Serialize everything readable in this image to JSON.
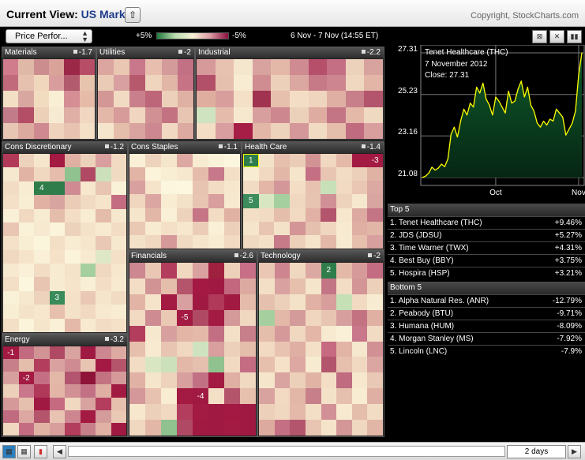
{
  "header": {
    "title_prefix": "Current View: ",
    "title_value": "US Market",
    "up_icon": "upload-arrow-icon",
    "copyright": "Copyright, StockCharts.com"
  },
  "toolbar": {
    "view_select": "Price Perfor...",
    "legend_pos": "+5%",
    "legend_neg": "-5%",
    "date_range": "6 Nov - 7 Nov (14:55 ET)",
    "buttons": [
      "zoom-icon",
      "tools-icon",
      "chart-icon"
    ]
  },
  "sectors": [
    {
      "name": "Materials",
      "change": "-1.7",
      "cols": 6,
      "rows": 5,
      "colors": [
        "#d07c8c",
        "#e0b8a8",
        "#cc8d8f",
        "#d9a399",
        "#9c2848",
        "#b84d68",
        "#c06a7c",
        "#e7c1b0",
        "#f0d6bc",
        "#d99d9e",
        "#b25a6e",
        "#e7c4ad",
        "#f3dfc4",
        "#d8a8a0",
        "#f2dcc0",
        "#f9efd5",
        "#d58e94",
        "#e6bca9",
        "#c27c89",
        "#b44e67",
        "#ecd0b8",
        "#f7ead2",
        "#dfaea5",
        "#f1d7c1",
        "#e8c6b4",
        "#dcaa9e",
        "#cf8a91",
        "#f0d3bd",
        "#e8c3b2",
        "#f3e0c6"
      ],
      "marks": []
    },
    {
      "name": "Utilities",
      "change": "-2",
      "cols": 6,
      "rows": 5,
      "colors": [
        "#dca6a0",
        "#e9c7b2",
        "#c8788a",
        "#e8bfae",
        "#d49b9b",
        "#c27185",
        "#eacbb6",
        "#d8a0a0",
        "#b7596c",
        "#efd5bd",
        "#e2b6a7",
        "#c67485",
        "#d39796",
        "#f2dbc3",
        "#c9808c",
        "#bd6679",
        "#ecd0ba",
        "#dfb0a4",
        "#e4b8a8",
        "#d79b9a",
        "#f0d6c0",
        "#d09094",
        "#c37282",
        "#e8c5b3",
        "#f5e5cc",
        "#e5bdab",
        "#d9a4a0",
        "#cc8790",
        "#f1d8c2",
        "#dcaaa1"
      ],
      "marks": []
    },
    {
      "name": "Industrial",
      "change": "-2.2",
      "cols": 10,
      "rows": 5,
      "colors": [
        "#d59a99",
        "#e8c2b1",
        "#f5e7cd",
        "#d8a29f",
        "#e3b8a8",
        "#cf8b92",
        "#b6506a",
        "#c46f83",
        "#edd2bb",
        "#d8a39f",
        "#b2506a",
        "#e6c0ae",
        "#f8ecd2",
        "#cf8d92",
        "#edd0ba",
        "#dba7a1",
        "#c67a87",
        "#cd8590",
        "#f0d7c0",
        "#e3b5a7",
        "#dfae9f",
        "#d79e9c",
        "#f3e0c6",
        "#a0334f",
        "#e6bfad",
        "#f3dec5",
        "#efd5be",
        "#dfafa3",
        "#c7808a",
        "#b3556c",
        "#cfe3c0",
        "#e5bcab",
        "#f6e8ce",
        "#d7a09e",
        "#cd878f",
        "#ecd1ba",
        "#dfaca2",
        "#c37585",
        "#e4b9a8",
        "#f0d9c1",
        "#f3dec5",
        "#d99fa0",
        "#a61d45",
        "#e3b7a8",
        "#eed3bc",
        "#d5989a",
        "#f1dbc2",
        "#e5bdab",
        "#c06b80",
        "#d99f9e"
      ],
      "marks": []
    },
    {
      "name": "Cons Discretionary",
      "change": "-1.2",
      "cols": 8,
      "rows": 13,
      "colors": [
        "#b23a59",
        "#edd2bb",
        "#f5e6cc",
        "#a31a42",
        "#e0b0a3",
        "#ecd1ba",
        "#d99e9e",
        "#f1d9c2",
        "#f5e8ce",
        "#e1b3a5",
        "#f0d7c0",
        "#e6bdac",
        "#8fc28f",
        "#b04a64",
        "#cde0bc",
        "#f0dac2",
        "#f2ddc4",
        "#f8edd3",
        "#e7c2b0",
        "#2e7d4b",
        "#cf8b91",
        "#f6e7cd",
        "#e8c4b2",
        "#f9f1d8",
        "#f3e0c6",
        "#f8eed4",
        "#e1b2a4",
        "#d8a49f",
        "#ebcdb7",
        "#f1dac2",
        "#f5e4ca",
        "#c46d82",
        "#f9f0d7",
        "#f0d8c1",
        "#f7ebd1",
        "#e5bdab",
        "#f3dec5",
        "#f8ecd2",
        "#e4bcaa",
        "#f6e8ce",
        "#e8c6b3",
        "#f9f1d8",
        "#f6e9cf",
        "#fbf4db",
        "#edd2bb",
        "#f4e2c8",
        "#f7ead0",
        "#f2dcc3",
        "#f4e1c7",
        "#f8eed4",
        "#fbf5dc",
        "#f3dfc6",
        "#f8ecd2",
        "#f5e6cc",
        "#e9c9b5",
        "#f6e8ce",
        "#f0d7c0",
        "#f5e4ca",
        "#f9f0d7",
        "#f4e1c7",
        "#fbf4db",
        "#f7ead0",
        "#dfe8c6",
        "#f3e0c6",
        "#f6e9cf",
        "#f9f0d7",
        "#f2dcc3",
        "#f7ebd1",
        "#f4e3c9",
        "#a6cf9f",
        "#f0d7c0",
        "#f6e7cd",
        "#f3dfc6",
        "#fbf6dd",
        "#e8c5b3",
        "#f7ebd1",
        "#f5e4ca",
        "#f9efd6",
        "#f3dec5",
        "#f7ead0",
        "#f9f1d8",
        "#f6e8ce",
        "#eed3bc",
        "#3a8b5a",
        "#f4e1c7",
        "#e9c9b5",
        "#f5e5cb",
        "#f2dbc3",
        "#f8eed4",
        "#f4e3c9",
        "#f6e7cd",
        "#e6bfad",
        "#f4e2c8",
        "#f1d8c1",
        "#f6e9cf",
        "#f8ecd2",
        "#f3dfc6",
        "#fbf4db",
        "#f5e5cb",
        "#f9f0d7",
        "#e4b9a9",
        "#f7ead0",
        "#f2dcc3",
        "#f4e1c7"
      ],
      "marks": [
        {
          "i": 18,
          "t": "4",
          "c": "#2e7d4b"
        },
        {
          "i": 83,
          "t": "3",
          "c": "#3a8b5a"
        }
      ]
    },
    {
      "name": "Cons Staples",
      "change": "-1.1",
      "cols": 7,
      "rows": 7,
      "colors": [
        "#f9f0d7",
        "#eed3bc",
        "#f5e5cb",
        "#dca8a1",
        "#f7ebd1",
        "#f9f1d8",
        "#fbf6dd",
        "#e2b4a6",
        "#fbf4db",
        "#f8eed4",
        "#f6e8ce",
        "#e5bcab",
        "#c7788a",
        "#f3dfc6",
        "#d8a09f",
        "#f5e4ca",
        "#fbf6dd",
        "#fcf7de",
        "#e7c3b1",
        "#f2dcc3",
        "#f6e7cd",
        "#f0d6bf",
        "#dba6a1",
        "#f8ecd2",
        "#f4e2c8",
        "#e8c5b3",
        "#d89f9e",
        "#f6e9cf",
        "#f5e5cb",
        "#e3b7a8",
        "#f9f0d7",
        "#eed3bc",
        "#c57585",
        "#f2dcc3",
        "#e0b2a4",
        "#e9c8b4",
        "#f7ebd1",
        "#f3e0c6",
        "#f6e7cd",
        "#ebcdb7",
        "#f9f0d7",
        "#ecd0ba",
        "#f4e2c8",
        "#f0d7c0",
        "#d6999a",
        "#f1dac2",
        "#f5e5cb",
        "#f8ecd2",
        "#f1d9c2"
      ],
      "marks": []
    },
    {
      "name": "Health Care",
      "change": "-1.4",
      "cols": 9,
      "rows": 7,
      "colors": [
        "#2e7d4b",
        "#f4e2c8",
        "#e6bfad",
        "#ebcdb7",
        "#d29395",
        "#f0d7c0",
        "#e4b9a8",
        "#a31a42",
        "#f4e1c7",
        "#f8ecd2",
        "#f0d8c1",
        "#e3b7a8",
        "#f5e5cb",
        "#c46f83",
        "#e8c5b3",
        "#f2dcc3",
        "#ecd0ba",
        "#e0b2a4",
        "#f2dbc3",
        "#e3b6a7",
        "#d3979a",
        "#f3dec5",
        "#e7c2b0",
        "#c8e0b8",
        "#f1d9c2",
        "#e9c7b4",
        "#dca9a2",
        "#3c8c5c",
        "#d9e6c2",
        "#a6cf9f",
        "#f0d7c0",
        "#e7c3b1",
        "#d09096",
        "#eed3bc",
        "#f6e8ce",
        "#d9a5a0",
        "#f3dfc6",
        "#f2dbc3",
        "#e5bdab",
        "#f1d9c2",
        "#e0b1a4",
        "#b3556c",
        "#f6e7cd",
        "#dcaaa1",
        "#c37585",
        "#f5e5cb",
        "#e8c5b3",
        "#f4e2c8",
        "#d39596",
        "#e6c0ae",
        "#f0d6bf",
        "#f7ead0",
        "#dfafa3",
        "#e2b6a7",
        "#f0d9c1",
        "#f3e0c6",
        "#c77a88",
        "#ecd0ba",
        "#f5e4ca",
        "#e3b8a8",
        "#f7ebd1",
        "#e6bfad",
        "#d7a09e"
      ],
      "marks": [
        {
          "i": 0,
          "t": "1",
          "c": "#2e7d4b",
          "b": true
        },
        {
          "i": 8,
          "t": "-3",
          "c": "#a31a42"
        },
        {
          "i": 27,
          "t": "5",
          "c": "#3c8c5c"
        }
      ]
    },
    {
      "name": "Financials",
      "change": "-2.6",
      "cols": 8,
      "rows": 11,
      "colors": [
        "#cc8790",
        "#e9c7b4",
        "#b23d5c",
        "#f0d7c0",
        "#d9a2a0",
        "#a0213f",
        "#ecd0ba",
        "#c76f86",
        "#f3dec5",
        "#d29395",
        "#e5bdab",
        "#b4556c",
        "#a41944",
        "#a01943",
        "#c2677d",
        "#dcaaa1",
        "#e1b4a6",
        "#f5e4ca",
        "#a31a42",
        "#d8a0a0",
        "#a01943",
        "#b03859",
        "#a11a42",
        "#e5bcab",
        "#f1d9c2",
        "#cf8b92",
        "#e9c8b4",
        "#f4e1c7",
        "#b04a64",
        "#a31a42",
        "#d49a99",
        "#f0d7c0",
        "#b23d5c",
        "#f6e8ce",
        "#d7a09e",
        "#e2b5a6",
        "#e4b9a9",
        "#c36f83",
        "#f3dfc6",
        "#c7808a",
        "#e6bfad",
        "#f7ead0",
        "#e8c5b3",
        "#f0d7c0",
        "#cfe3c0",
        "#d89f9e",
        "#ecd0ba",
        "#e5bdab",
        "#f2dcc3",
        "#d9e6c2",
        "#cde0bc",
        "#e3b8a8",
        "#e6c0ae",
        "#8fc28f",
        "#f1d9c2",
        "#c46d82",
        "#e0b1a4",
        "#f5e5cb",
        "#eed3bc",
        "#d7a09e",
        "#c27185",
        "#a31a42",
        "#dfafa3",
        "#f0d8c1",
        "#d5989a",
        "#e7c2b0",
        "#f8ecd2",
        "#a31a42",
        "#a01943",
        "#f3e0c6",
        "#b4556c",
        "#e6bfad",
        "#f6e7cd",
        "#ecd0ba",
        "#f1d8c1",
        "#b23d5c",
        "#a31a42",
        "#a01943",
        "#a41944",
        "#a01943",
        "#f0d7c0",
        "#e3b7a8",
        "#8fc28f",
        "#b04a64",
        "#a11a42",
        "#a01943",
        "#a31a42",
        "#a01943"
      ],
      "marks": [
        {
          "i": 27,
          "t": "-5",
          "c": "#a31a42"
        },
        {
          "i": 68,
          "t": "-4",
          "c": "#a01943"
        }
      ]
    },
    {
      "name": "Technology",
      "change": "-2",
      "cols": 8,
      "rows": 11,
      "colors": [
        "#e9c7b4",
        "#cd8590",
        "#f0d7c0",
        "#dca9a2",
        "#2e7d4b",
        "#e4b9a8",
        "#d59a99",
        "#c46d82",
        "#f3dfc6",
        "#d9a2a0",
        "#e6bfad",
        "#f5e5cb",
        "#c37585",
        "#f2dcc3",
        "#d39596",
        "#ecd0ba",
        "#e6c0ae",
        "#ecd0ba",
        "#f4e2c8",
        "#e0b1a4",
        "#d79e9c",
        "#c5e0b5",
        "#f1d9c2",
        "#f7ebd1",
        "#a6cf9f",
        "#e3b8a8",
        "#d49b9b",
        "#f0d6bf",
        "#e8c5b3",
        "#d7a09e",
        "#c37282",
        "#e0b0a3",
        "#e5bdab",
        "#d6999a",
        "#f0d7c0",
        "#e3b6a7",
        "#f7ead0",
        "#f9f0d7",
        "#c8788a",
        "#f2dbc3",
        "#f1d9c2",
        "#e8c3b2",
        "#dfafa3",
        "#f3e0c6",
        "#c56a80",
        "#e2b4a6",
        "#f6e8ce",
        "#d09094",
        "#e6bfad",
        "#f4e1c7",
        "#dca8a1",
        "#f7ebd1",
        "#b3556c",
        "#e6bfad",
        "#f0d8c1",
        "#dba6a1",
        "#f5e5cb",
        "#d9a4a0",
        "#ecd0ba",
        "#e1b3a5",
        "#f3dec5",
        "#c06b80",
        "#f6e7cd",
        "#e9c9b5",
        "#d8a39f",
        "#f1d9c2",
        "#e3b7a8",
        "#c7808a",
        "#f4e2c8",
        "#e6c0ae",
        "#f8ecd2",
        "#dfafa3",
        "#ecd0ba",
        "#f0d7c0",
        "#e4b9a9",
        "#f3dfc6",
        "#d09096",
        "#f7ead0",
        "#e5bdab",
        "#f2dcc3",
        "#dcaa9e",
        "#c46f83",
        "#b3556c",
        "#e8c5b3",
        "#f5e4ca",
        "#d39797",
        "#f0d7c0",
        "#e2b6a7"
      ],
      "marks": [
        {
          "i": 4,
          "t": "2",
          "c": "#2e7d4b"
        }
      ]
    },
    {
      "name": "Energy",
      "change": "-3.2",
      "cols": 8,
      "rows": 7,
      "colors": [
        "#a31a42",
        "#c26b80",
        "#d29395",
        "#b04a64",
        "#d9a4a0",
        "#a01943",
        "#cc8790",
        "#dcaaa1",
        "#c7808a",
        "#e5bdab",
        "#b23d5c",
        "#d9a2a0",
        "#cf8b92",
        "#e8c5b3",
        "#a41944",
        "#b4556c",
        "#d7a09e",
        "#a31a42",
        "#c46f83",
        "#e3b8a8",
        "#b45570",
        "#8f1339",
        "#c37282",
        "#d59a99",
        "#ecd0ba",
        "#c8788a",
        "#b03859",
        "#e2b5a6",
        "#d09094",
        "#c27185",
        "#dfafa3",
        "#a11a42",
        "#d6999a",
        "#e6c0ae",
        "#a01943",
        "#c56a80",
        "#f0d7c0",
        "#d8a39f",
        "#b23d5c",
        "#e6bfad",
        "#c06b80",
        "#dca8a1",
        "#b4556c",
        "#e8c3b2",
        "#cd8590",
        "#a31a42",
        "#d49b9b",
        "#e9c8b4",
        "#f0d7c0",
        "#c46d82",
        "#e1b3a5",
        "#d79e9c",
        "#b23d5c",
        "#c7808a",
        "#e0b1a4",
        "#a01943"
      ],
      "marks": [
        {
          "i": 0,
          "t": "-1",
          "c": "#a31a42"
        },
        {
          "i": 17,
          "t": "-2",
          "c": "#a31a42"
        }
      ]
    }
  ],
  "chart": {
    "title": "Tenet Healthcare (THC)",
    "date": "7 November 2012",
    "close": "Close: 27.31",
    "y_ticks": [
      "27.31",
      "25.23",
      "23.16",
      "21.08"
    ],
    "x_ticks": [
      "Oct",
      "Nov"
    ],
    "ylim": [
      21.08,
      27.31
    ],
    "line_color": "#ffff00"
  },
  "chart_data": {
    "type": "line",
    "title": "Tenet Healthcare (THC)",
    "xlabel": "",
    "ylabel": "",
    "ylim": [
      21.08,
      27.31
    ],
    "series": [
      {
        "name": "Tenet Healthcare (THC)",
        "values": [
          21.08,
          21.15,
          21.3,
          21.6,
          21.45,
          21.55,
          21.75,
          21.62,
          22.0,
          23.25,
          23.6,
          23.1,
          23.9,
          24.5,
          24.2,
          24.8,
          24.6,
          25.6,
          25.3,
          25.8,
          25.0,
          24.7,
          24.2,
          25.1,
          24.9,
          24.6,
          24.3,
          25.4,
          24.8,
          24.9,
          25.5,
          25.9,
          25.1,
          25.6,
          24.7,
          24.4,
          23.8,
          23.6,
          23.9,
          23.7,
          24.0,
          23.9,
          24.5,
          24.3,
          24.1,
          23.2,
          23.5,
          23.8,
          24.4,
          26.2,
          27.31
        ]
      }
    ]
  },
  "top5": {
    "title": "Top 5",
    "items": [
      {
        "label": "1. Tenet Healthcare (THC)",
        "value": "+9.46%"
      },
      {
        "label": "2. JDS (JDSU)",
        "value": "+5.27%"
      },
      {
        "label": "3. Time Warner (TWX)",
        "value": "+4.31%"
      },
      {
        "label": "4. Best Buy (BBY)",
        "value": "+3.75%"
      },
      {
        "label": "5. Hospira (HSP)",
        "value": "+3.21%"
      }
    ]
  },
  "bottom5": {
    "title": "Bottom 5",
    "items": [
      {
        "label": "1. Alpha Natural Res. (ANR)",
        "value": "-12.79%"
      },
      {
        "label": "2. Peabody (BTU)",
        "value": "-9.71%"
      },
      {
        "label": "3. Humana (HUM)",
        "value": "-8.09%"
      },
      {
        "label": "4. Morgan Stanley (MS)",
        "value": "-7.92%"
      },
      {
        "label": "5. Lincoln (LNC)",
        "value": "-7.9%"
      }
    ]
  },
  "footer": {
    "period": "2 days",
    "left_arrow": "◀",
    "right_arrow": "▶"
  }
}
